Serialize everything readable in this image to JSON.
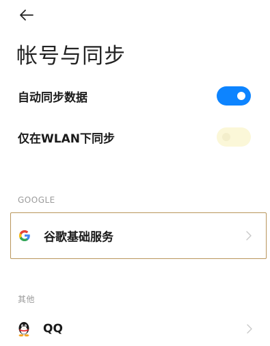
{
  "header": {
    "back_icon": "arrow-left-icon",
    "title": "帐号与同步"
  },
  "settings": {
    "auto_sync": {
      "label": "自动同步数据",
      "enabled": true
    },
    "wlan_sync": {
      "label": "仅在WLAN下同步",
      "enabled": false
    }
  },
  "sections": {
    "google": {
      "header": "GOOGLE",
      "items": [
        {
          "label": "谷歌基础服务",
          "icon": "google-g-icon"
        }
      ]
    },
    "other": {
      "header": "其他",
      "items": [
        {
          "label": "QQ",
          "icon": "qq-penguin-icon"
        }
      ]
    }
  },
  "colors": {
    "accent": "#0d84ff",
    "toggle_off": "#fbf7d8",
    "focus_border": "#b8955a",
    "section_text": "#9a9a9a"
  }
}
